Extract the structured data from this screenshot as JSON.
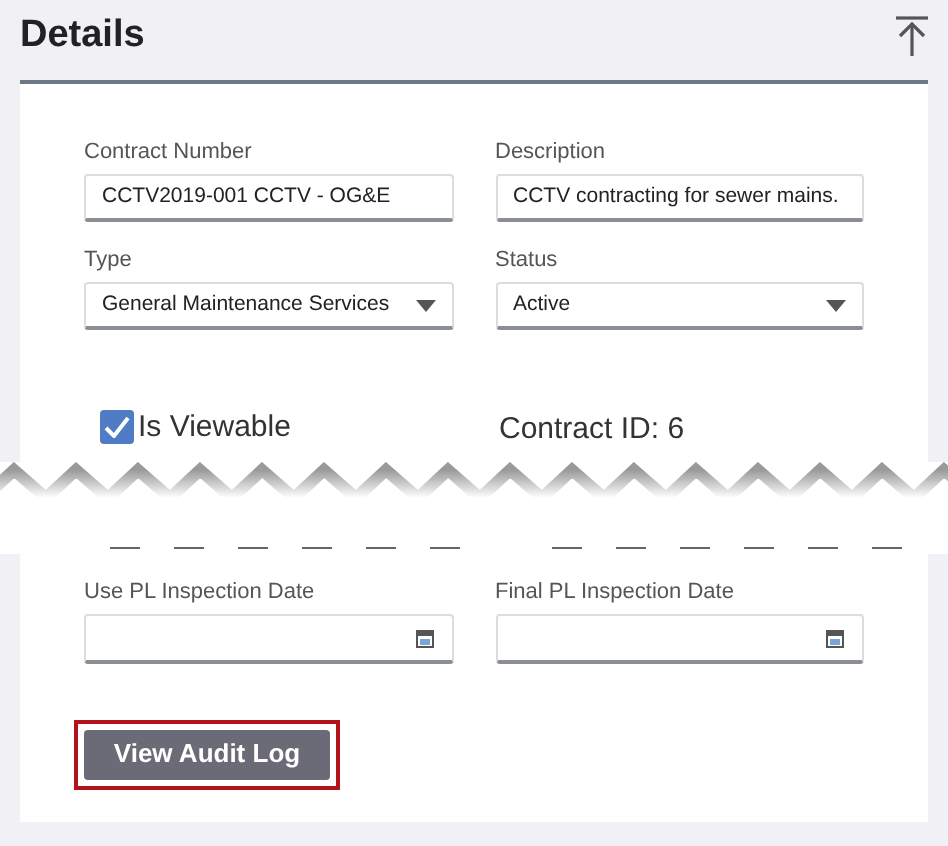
{
  "header": {
    "title": "Details"
  },
  "fields": [
    {
      "kind": "text",
      "label": "Contract Number",
      "value": "CCTV2019-001 CCTV - OG&E"
    },
    {
      "kind": "text",
      "label": "Description",
      "value": "CCTV contracting for sewer mains."
    },
    {
      "kind": "select",
      "label": "Type",
      "value": "General Maintenance Services"
    },
    {
      "kind": "select",
      "label": "Status",
      "value": "Active"
    }
  ],
  "is_viewable": {
    "label": "Is Viewable",
    "checked": true
  },
  "contract_id": "Contract ID: 6",
  "date_fields": [
    {
      "label": "Use PL Inspection Date"
    },
    {
      "label": "Final PL Inspection Date"
    }
  ],
  "audit_button": {
    "label": "View Audit Log",
    "highlighted": true
  }
}
